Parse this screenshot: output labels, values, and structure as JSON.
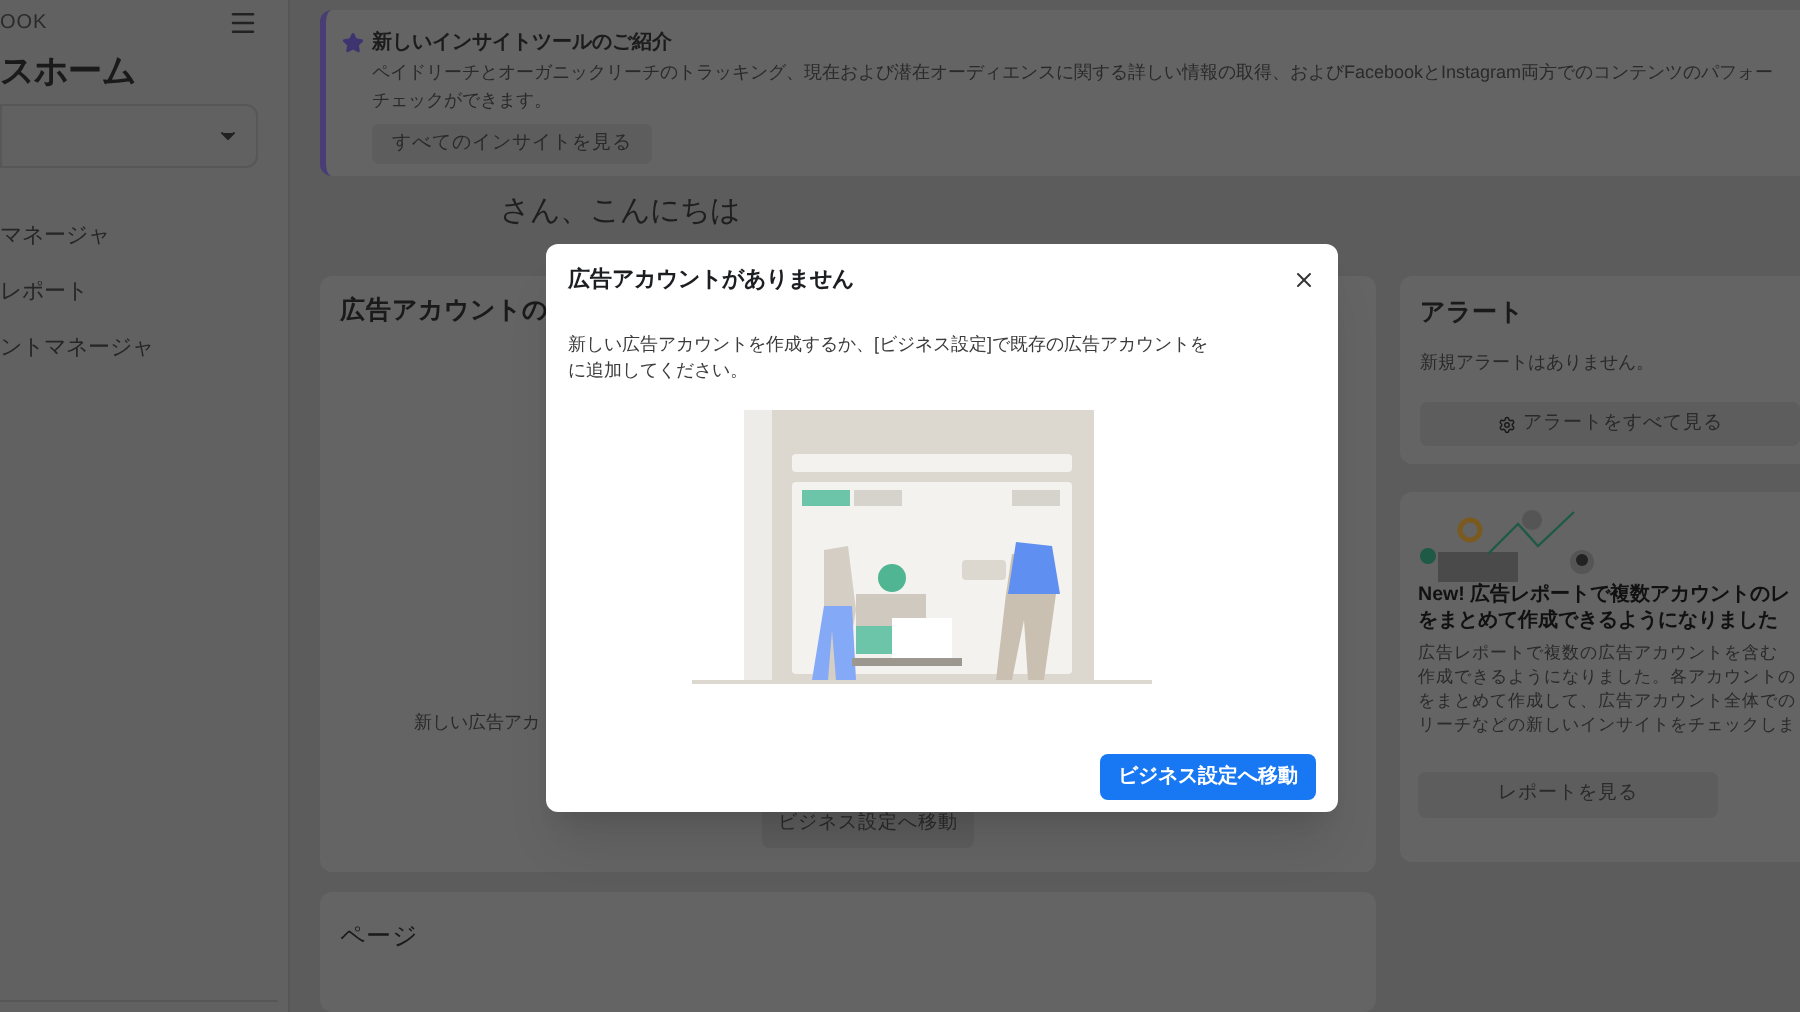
{
  "sidebar": {
    "brand": "OOK",
    "title": "スホーム",
    "items": [
      {
        "label": "マネージャ"
      },
      {
        "label": "レポート"
      },
      {
        "label": "ントマネージャ"
      }
    ]
  },
  "banner": {
    "title": "新しいインサイトツールのご紹介",
    "lines": [
      "ペイドリーチとオーガニックリーチのトラッキング、現在および潜在オーディエンスに関する詳しい情報の取得、およびFacebookとInstagram両方でのコンテンツのパフォー",
      "チェックができます。"
    ],
    "button": "すべてのインサイトを見る"
  },
  "greeting": "さん、こんにちは",
  "ad_accounts_card": {
    "title": "広告アカウントの",
    "text": "新しい広告アカ",
    "button": "ビジネス設定へ移動"
  },
  "pages_card": {
    "title": "ページ"
  },
  "alerts_card": {
    "title": "アラート",
    "text": "新規アラートはありません。",
    "button": "アラートをすべて見る"
  },
  "news_card": {
    "title_lines": [
      "New! 広告レポートで複数アカウントのレ",
      "をまとめて作成できるようになりました"
    ],
    "body_lines": [
      "広告レポートで複数の広告アカウントを含む",
      "作成できるようになりました。各アカウントの",
      "をまとめて作成して、広告アカウント全体での",
      "リーチなどの新しいインサイトをチェックしま"
    ],
    "button": "レポートを見る"
  },
  "dialog": {
    "title": "広告アカウントがありません",
    "lines": [
      "新しい広告アカウントを作成するか、[ビジネス設定]で既存の広告アカウントを",
      "に追加してください。"
    ],
    "button": "ビジネス設定へ移動"
  }
}
